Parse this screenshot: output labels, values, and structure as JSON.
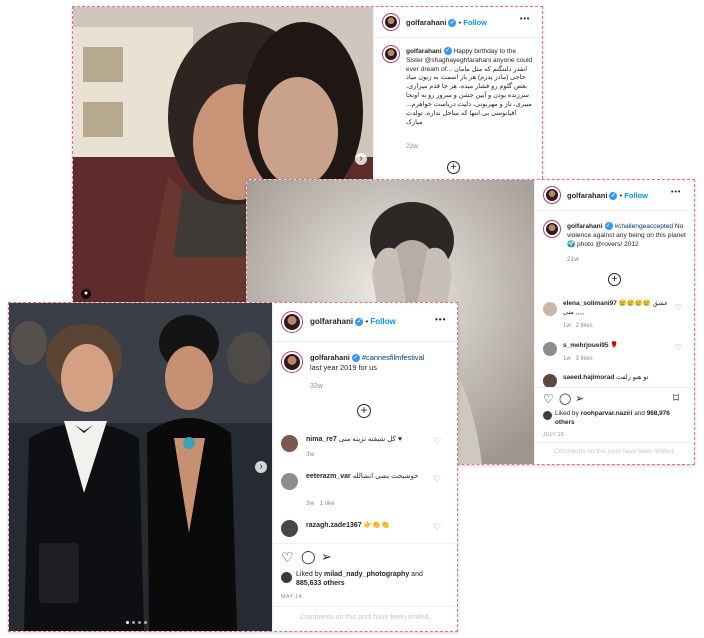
{
  "post1": {
    "username": "golfarahani",
    "follow": "Follow",
    "more": "•••",
    "caption_user": "golfarahani",
    "caption_text": "Happy birthday to the Sister @shaghayeghfarahani anyone could ever dream of... انقدر دلتنگتم که مثل مامان حاجی (مادر پدرم) هر بار اسمت به زبون میاد بغض گلوم رو فشار میده، هر جا قدم میزاری، سرزنده بودن و آیین جشن و سرور رو به اونجا میبری، ناز و مهربونی، دلیت دریاست خواهرم... اقیانوسی بی انتها که ساحل نداره، تولدت مبارک",
    "time": "22w"
  },
  "post2": {
    "username": "golfarahani",
    "follow": "Follow",
    "more": "•••",
    "caption_user": "golfarahani",
    "caption_tag": "#challengeaccepted",
    "caption_text": "No violence against any being on this planet 🌍 photo @rovers/ 2012",
    "time": "21w",
    "comments": [
      {
        "user": "elena_solimani97",
        "text": "😢😢😢😢 عشق منی ,,,,,",
        "meta": "1w   2 likes"
      },
      {
        "user": "s_mehrjouei95",
        "text": "🌹",
        "meta": "1w   3 likes"
      },
      {
        "user": "saeed.hajimorad",
        "text": "تو هنو زلفت",
        "meta": ""
      }
    ],
    "liked_by_prefix": "Liked by",
    "liked_by_user": "roohparvar.naziri",
    "liked_by_and": "and",
    "likes": "968,976 others",
    "date": "JULY 19",
    "limited": "Comments on this post have been limited."
  },
  "post3": {
    "username": "golfarahani",
    "follow": "Follow",
    "more": "•••",
    "caption_user": "golfarahani",
    "caption_tag": "#cannesfilmfestival",
    "caption_text": "last year 2019 for us",
    "time": "32w",
    "comments": [
      {
        "user": "nima_re7",
        "text": "کل شیفته ترینه منی ♥",
        "meta": "3w"
      },
      {
        "user": "eeterazm_var",
        "text": "خوشبخت بشی انشالله",
        "meta": "3w   1 like"
      },
      {
        "user": "razagh.zade1367",
        "text": "👉👏👏",
        "meta": ""
      }
    ],
    "liked_by_prefix": "Liked by",
    "liked_by_user": "milad_nady_photography",
    "liked_by_and": "and",
    "likes": "885,633 others",
    "date": "MAY 14",
    "limited": "Comments on this post have been limited."
  },
  "colors": {
    "follow": "#0095f6",
    "verified": "#3897f0",
    "frame": "#e06d8d"
  },
  "icons": [
    "verified-badge-icon",
    "heart-icon",
    "comment-icon",
    "share-icon",
    "bookmark-icon",
    "add-comment-icon",
    "next-arrow-icon",
    "tagged-person-icon"
  ]
}
